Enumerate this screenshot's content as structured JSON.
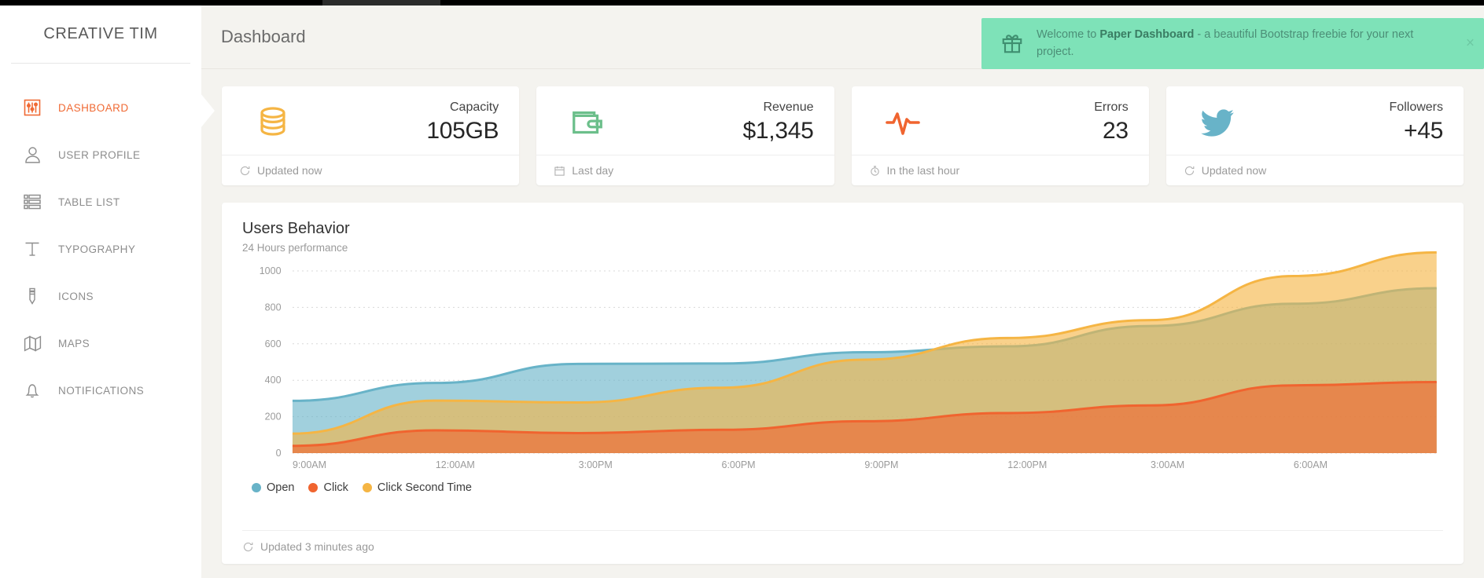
{
  "brand": {
    "name": "CREATIVE TIM"
  },
  "sidebar": {
    "items": [
      {
        "label": "DASHBOARD",
        "icon": "sliders-icon",
        "active": true
      },
      {
        "label": "USER PROFILE",
        "icon": "user-icon",
        "active": false
      },
      {
        "label": "TABLE LIST",
        "icon": "table-icon",
        "active": false
      },
      {
        "label": "TYPOGRAPHY",
        "icon": "text-icon",
        "active": false
      },
      {
        "label": "ICONS",
        "icon": "pencil-icon",
        "active": false
      },
      {
        "label": "MAPS",
        "icon": "map-icon",
        "active": false
      },
      {
        "label": "NOTIFICATIONS",
        "icon": "bell-icon",
        "active": false
      }
    ]
  },
  "header": {
    "title": "Dashboard"
  },
  "alert": {
    "icon": "gift-icon",
    "text_before": "Welcome to ",
    "text_bold": "Paper Dashboard",
    "text_after": " - a beautiful Bootstrap freebie for your next project.",
    "close_label": "×",
    "background": "#7ee2b8",
    "text_color": "#4c8f77"
  },
  "stats": [
    {
      "icon": "database-icon",
      "icon_color": "#f5b544",
      "label": "Capacity",
      "value": "105GB",
      "foot_icon": "refresh-icon",
      "foot": "Updated now"
    },
    {
      "icon": "wallet-icon",
      "icon_color": "#6cbf8b",
      "label": "Revenue",
      "value": "$1,345",
      "foot_icon": "calendar-icon",
      "foot": "Last day"
    },
    {
      "icon": "pulse-icon",
      "icon_color": "#f0642f",
      "label": "Errors",
      "value": "23",
      "foot_icon": "clock-icon",
      "foot": "In the last hour"
    },
    {
      "icon": "twitter-icon",
      "icon_color": "#68b3c8",
      "label": "Followers",
      "value": "+45",
      "foot_icon": "refresh-icon",
      "foot": "Updated now"
    }
  ],
  "chart_card": {
    "title": "Users Behavior",
    "subtitle": "24 Hours performance",
    "foot_icon": "refresh-icon",
    "foot": "Updated 3 minutes ago"
  },
  "chart_data": {
    "type": "area",
    "title": "Users Behavior",
    "subtitle": "24 Hours performance",
    "xlabel": "",
    "ylabel": "",
    "ylim": [
      0,
      1000
    ],
    "yticks": [
      0,
      200,
      400,
      600,
      800,
      1000
    ],
    "grid": true,
    "legend_position": "bottom-left",
    "stacked": true,
    "x": [
      "9:00AM",
      "12:00AM",
      "3:00PM",
      "6:00PM",
      "9:00PM",
      "12:00PM",
      "3:00AM",
      "6:00AM"
    ],
    "x_tick_labels": [
      "9:00AM",
      "12:00AM",
      "3:00PM",
      "6:00PM",
      "9:00PM",
      "12:00PM",
      "3:00AM",
      "6:00AM"
    ],
    "series": [
      {
        "name": "Open",
        "color": "#68b3c8",
        "values": [
          287,
          385,
          490,
          492,
          554,
          586,
          698,
          820,
          905
        ]
      },
      {
        "name": "Click",
        "color": "#f0642f",
        "values": [
          40,
          125,
          110,
          128,
          175,
          220,
          262,
          372,
          390
        ]
      },
      {
        "name": "Click Second Time",
        "color": "#f5b544",
        "values": [
          67,
          163,
          168,
          231,
          338,
          412,
          468,
          600,
          712
        ]
      }
    ]
  }
}
